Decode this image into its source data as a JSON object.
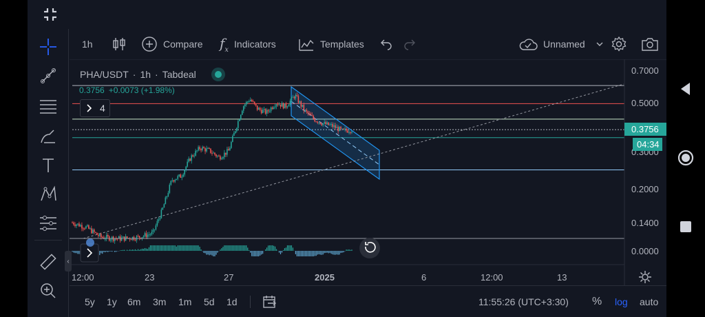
{
  "toolbar": {
    "interval": "1h",
    "compare_label": "Compare",
    "indicators_label": "Indicators",
    "templates_label": "Templates",
    "layout_name": "Unnamed"
  },
  "legend": {
    "symbol": "PHA/USDT",
    "interval": "1h",
    "exchange": "Tabdeal",
    "sep": "·",
    "price_line": "0.3756",
    "change": "+0.0073 (+1.98%)",
    "indicator_count": "4"
  },
  "price_badge": {
    "price": "0.3756",
    "countdown": "04:34"
  },
  "bottom": {
    "ranges": [
      "5y",
      "1y",
      "6m",
      "3m",
      "1m",
      "5d",
      "1d"
    ],
    "time": "11:55:26 (UTC+3:30)",
    "percent": "%",
    "log": "log",
    "auto": "auto"
  },
  "colors": {
    "background": "#131722",
    "up": "#26a69a",
    "down": "#ef5350",
    "accent": "#2962ff",
    "channel": "#2196f3"
  },
  "chart_data": {
    "type": "candlestick",
    "scale": "log",
    "price_ticks": [
      "0.7000",
      "0.5000",
      "0.3000",
      "0.2000",
      "0.1400"
    ],
    "oscillator_tick": "0.0000",
    "time_ticks": [
      "12:00",
      "23",
      "27",
      "2025",
      "6",
      "12:00",
      "13"
    ],
    "close_path": [
      {
        "t": 0.0,
        "p": 0.14
      },
      {
        "t": 0.03,
        "p": 0.133
      },
      {
        "t": 0.06,
        "p": 0.12
      },
      {
        "t": 0.1,
        "p": 0.118
      },
      {
        "t": 0.14,
        "p": 0.12
      },
      {
        "t": 0.17,
        "p": 0.125
      },
      {
        "t": 0.19,
        "p": 0.16
      },
      {
        "t": 0.21,
        "p": 0.22
      },
      {
        "t": 0.23,
        "p": 0.23
      },
      {
        "t": 0.25,
        "p": 0.28
      },
      {
        "t": 0.27,
        "p": 0.31
      },
      {
        "t": 0.29,
        "p": 0.3
      },
      {
        "t": 0.31,
        "p": 0.28
      },
      {
        "t": 0.33,
        "p": 0.3
      },
      {
        "t": 0.345,
        "p": 0.38
      },
      {
        "t": 0.36,
        "p": 0.48
      },
      {
        "t": 0.375,
        "p": 0.52
      },
      {
        "t": 0.39,
        "p": 0.47
      },
      {
        "t": 0.41,
        "p": 0.45
      },
      {
        "t": 0.43,
        "p": 0.5
      },
      {
        "t": 0.45,
        "p": 0.48
      },
      {
        "t": 0.47,
        "p": 0.54
      },
      {
        "t": 0.49,
        "p": 0.46
      },
      {
        "t": 0.51,
        "p": 0.42
      },
      {
        "t": 0.53,
        "p": 0.4
      },
      {
        "t": 0.55,
        "p": 0.39
      },
      {
        "t": 0.57,
        "p": 0.37
      },
      {
        "t": 0.59,
        "p": 0.3756
      }
    ],
    "horizontal_levels": [
      {
        "price": 0.6,
        "color": "#b2b5be"
      },
      {
        "price": 0.495,
        "color": "#ef5350"
      },
      {
        "price": 0.42,
        "color": "#c8e6c9"
      },
      {
        "price": 0.3756,
        "color": "#b2b5be"
      },
      {
        "price": 0.345,
        "color": "#26a69a"
      },
      {
        "price": 0.245,
        "color": "#90caf9"
      }
    ]
  }
}
